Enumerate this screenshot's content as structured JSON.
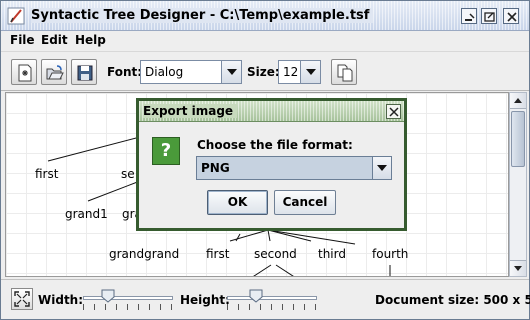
{
  "window": {
    "title": "Syntactic Tree Designer - C:\\Temp\\example.tsf"
  },
  "icons": {
    "app": "app-logo-icon",
    "minimize": "minimize-icon",
    "maximize": "maximize-icon",
    "close": "close-icon",
    "new": "new-document-icon",
    "open": "open-folder-icon",
    "save": "save-disk-icon",
    "copy": "copy-icon",
    "fit": "fit-to-window-icon",
    "question": "question-icon"
  },
  "menu": {
    "items": [
      "File",
      "Edit",
      "Help"
    ]
  },
  "toolbar": {
    "font_label": "Font:",
    "font_value": "Dialog",
    "size_label": "Size:",
    "size_value": "12"
  },
  "tree": {
    "nodes": {
      "first": "first",
      "second_partial": "se",
      "grand1": "grand1",
      "grand_partial": "gra",
      "grandgrand": "grandgrand",
      "first2": "first",
      "second2": "second",
      "third": "third",
      "fourth": "fourth"
    }
  },
  "bottom": {
    "width_label": "Width:",
    "height_label": "Height:",
    "document_size": "Document size: 500 x 500",
    "width_level": 0.24,
    "height_level": 0.29
  },
  "dialog": {
    "title": "Export image",
    "icon_glyph": "?",
    "prompt": "Choose the file format:",
    "format_value": "PNG",
    "ok_label": "OK",
    "cancel_label": "Cancel"
  },
  "colors": {
    "title_bar": "#d6e0f0",
    "dialog_border": "#365b2f",
    "dialog_title": "#b7cfae",
    "question_icon": "#4a9a3a",
    "selected_combo": "#c6d2e0"
  }
}
